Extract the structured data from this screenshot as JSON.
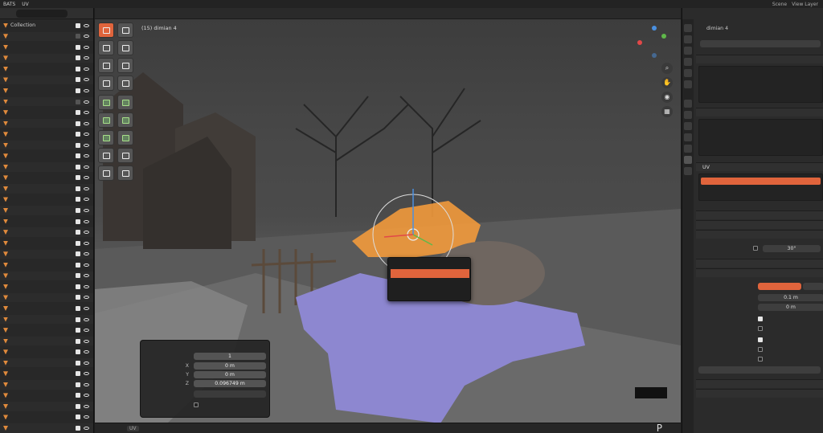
{
  "topbar": {
    "workspaces": [
      "BATS",
      "UV"
    ],
    "scene_label": "Scene",
    "view_layer_label": "View Layer"
  },
  "outliner": {
    "rows": [
      {
        "label": "Collection",
        "checked": true
      },
      {
        "label": "",
        "checked": false
      },
      {
        "label": "",
        "checked": true
      },
      {
        "label": "",
        "checked": true
      },
      {
        "label": "",
        "checked": true
      },
      {
        "label": "",
        "checked": true
      },
      {
        "label": "",
        "checked": true
      },
      {
        "label": "",
        "checked": false
      },
      {
        "label": "",
        "checked": true
      },
      {
        "label": "",
        "checked": true
      },
      {
        "label": "",
        "checked": true
      },
      {
        "label": "",
        "checked": true
      },
      {
        "label": "",
        "checked": true
      },
      {
        "label": "",
        "checked": true
      },
      {
        "label": "",
        "checked": true
      },
      {
        "label": "",
        "checked": true
      },
      {
        "label": "",
        "checked": true
      },
      {
        "label": "",
        "checked": true
      },
      {
        "label": "",
        "checked": true
      },
      {
        "label": "",
        "checked": true
      },
      {
        "label": "",
        "checked": true
      },
      {
        "label": "",
        "checked": true
      },
      {
        "label": "",
        "checked": true
      },
      {
        "label": "",
        "checked": true
      },
      {
        "label": "",
        "checked": true
      },
      {
        "label": "",
        "checked": true
      },
      {
        "label": "",
        "checked": true
      },
      {
        "label": "",
        "checked": true
      },
      {
        "label": "",
        "checked": true
      },
      {
        "label": "",
        "checked": true
      },
      {
        "label": "",
        "checked": true
      },
      {
        "label": "",
        "checked": true
      },
      {
        "label": "",
        "checked": true
      },
      {
        "label": "",
        "checked": true
      },
      {
        "label": "",
        "checked": true
      },
      {
        "label": "",
        "checked": true
      },
      {
        "label": "",
        "checked": true
      },
      {
        "label": "",
        "checked": true
      }
    ]
  },
  "viewport": {
    "info_line1": "",
    "info_line2": "(15) dimian 4",
    "context_menu": {
      "title": "",
      "items": [
        "",
        "",
        ""
      ],
      "selected_index": 0
    },
    "redo_panel": {
      "title": "",
      "fields": [
        {
          "label": "",
          "value": "1"
        },
        {
          "label": "X",
          "value": "0 m"
        },
        {
          "label": "Y",
          "value": "0 m"
        },
        {
          "label": "Z",
          "value": "0.096749 m"
        },
        {
          "label": "",
          "value": ""
        }
      ],
      "checkbox_label": ""
    },
    "footer_items": [
      "",
      "",
      "",
      "UV"
    ],
    "corner_letter": "P"
  },
  "properties": {
    "object_name": "dimian 4",
    "mesh_name": "",
    "sections": [
      "",
      "",
      "UV",
      "",
      "",
      ""
    ],
    "uv_map_name": "",
    "auto_smooth_value": "30°",
    "voxel_size": "0.1 m",
    "adaptivity": "0 m",
    "bottom_sections": [
      "",
      ""
    ]
  },
  "colors": {
    "accent": "#e0643c",
    "mesh_blue": "#8d87d0",
    "selection_orange": "#f29a3c"
  }
}
